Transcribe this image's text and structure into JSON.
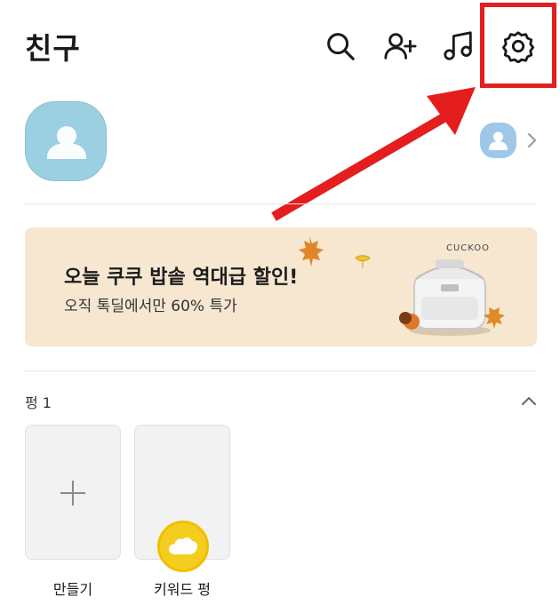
{
  "header": {
    "title": "친구"
  },
  "icons": {
    "search": "search-icon",
    "add_friend": "add-friend-icon",
    "music": "music-note-icon",
    "settings": "gear-icon"
  },
  "banner": {
    "title": "오늘 쿠쿠 밥솥 역대급 할인!",
    "subtitle": "오직 톡딜에서만 60% 특가",
    "brand": "CUCKOO"
  },
  "section": {
    "label": "펑 1"
  },
  "cards": [
    {
      "label": "만들기"
    },
    {
      "label": "키워드 펑"
    }
  ],
  "colors": {
    "highlight": "#e41e1e",
    "banner_bg": "#f7e7d1",
    "avatar_bg": "#9ad0e2",
    "badge": "#f5cd1e"
  }
}
